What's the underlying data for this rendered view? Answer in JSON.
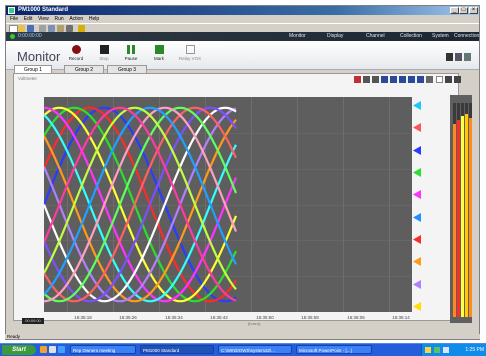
{
  "window": {
    "title": "PM1000 Standard",
    "controls": [
      "_",
      "□",
      "×"
    ]
  },
  "menu": [
    "File",
    "Edit",
    "View",
    "Run",
    "Action",
    "Help"
  ],
  "header": {
    "clock": "0:00:00:00",
    "nav": [
      "Monitor",
      "Display",
      "Channel",
      "Collection",
      "System",
      "Connection"
    ]
  },
  "monitor": {
    "title": "Monitor",
    "controls": [
      {
        "label": "Record",
        "icon": "record-icon",
        "enabled": true
      },
      {
        "label": "Stop",
        "icon": "stop-icon",
        "enabled": false
      },
      {
        "label": "Pause",
        "icon": "pause-icon",
        "enabled": true
      },
      {
        "label": "Mark",
        "icon": "flag-icon",
        "enabled": true
      },
      {
        "label": "Relay VOX",
        "icon": "relay-icon",
        "enabled": false
      }
    ]
  },
  "tabs": [
    {
      "label": "Group 1",
      "active": true
    },
    {
      "label": "Group 2",
      "active": false
    },
    {
      "label": "Group 3",
      "active": false
    }
  ],
  "panel": {
    "title": "Voltmeter"
  },
  "chart_data": {
    "type": "line",
    "title": "",
    "xlabel": "",
    "ylabel": "",
    "x_ticks": [
      "16:35:18",
      "16:35:26",
      "16:35:34",
      "16:35:42",
      "16:35:50",
      "16:35:58",
      "16:36:06",
      "16:36:14"
    ],
    "grid": true,
    "legend": "none",
    "data_end_fraction_of_axis": 0.525,
    "series_colors": [
      "#2a3cff",
      "#ff2a2a",
      "#2ae02a",
      "#ffff33",
      "#ff33ff",
      "#33ffff",
      "#ff9a1a",
      "#b080ff",
      "#ffffff",
      "#7a50ff",
      "#ff6060",
      "#60ff60",
      "#ffa0c0",
      "#20a0ff",
      "#c0ff40",
      "#ff3aa0"
    ],
    "series_phase_deg": [
      0,
      22,
      45,
      67,
      90,
      112,
      135,
      157,
      180,
      202,
      225,
      247,
      270,
      292,
      315,
      337
    ],
    "series_type": "sinusoid",
    "period_fraction_of_data_span": 1.25
  },
  "status": {
    "text": "Ready"
  },
  "marks_colors": [
    "#1ec8ff",
    "#ff5555",
    "#2a3cff",
    "#2ae02a",
    "#ff33ff",
    "#1e90ff",
    "#ff2a2a",
    "#ff9a1a",
    "#b080ff",
    "#ffdd00"
  ],
  "meter": {
    "colors": [
      "#ff8c1a",
      "#ff2a2a",
      "#ffff44",
      "#ffcc00",
      "#ff8c1a"
    ],
    "levels": [
      0.9,
      0.92,
      0.94,
      0.95,
      0.93
    ]
  },
  "time_readout": "00:00:00",
  "x_units": "(h:m:s)",
  "taskbar": {
    "start": "Start",
    "tasks": [
      {
        "label": "Rep Owners meeting",
        "active": false
      },
      {
        "label": "PM1000 Standard",
        "active": true
      },
      {
        "label": "C:\\WINDOWS\\system32\\...",
        "active": false
      },
      {
        "label": "Microsoft PowerPoint - [...]",
        "active": false
      }
    ],
    "clock": "1:25 PM"
  }
}
